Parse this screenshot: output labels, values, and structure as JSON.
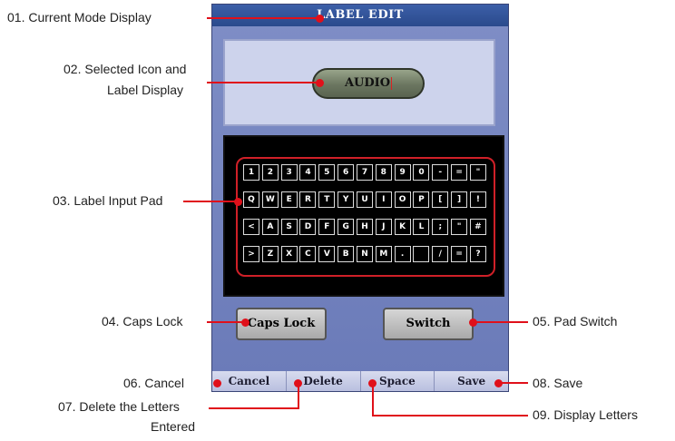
{
  "screen": {
    "title": "LABEL EDIT",
    "selected_label": "AUDIO",
    "keyboard_rows": [
      [
        "1",
        "2",
        "3",
        "4",
        "5",
        "6",
        "7",
        "8",
        "9",
        "0",
        "-",
        "=",
        "\""
      ],
      [
        "Q",
        "W",
        "E",
        "R",
        "T",
        "Y",
        "U",
        "I",
        "O",
        "P",
        "[",
        "]",
        "!"
      ],
      [
        "<",
        "A",
        "S",
        "D",
        "F",
        "G",
        "H",
        "J",
        "K",
        "L",
        ";",
        "\"",
        "#"
      ],
      [
        ">",
        "Z",
        "X",
        "C",
        "V",
        "B",
        "N",
        "M",
        ".",
        "",
        "/",
        "=",
        "?"
      ]
    ],
    "caps_lock_label": "Caps Lock",
    "switch_label": "Switch",
    "bottom_buttons": [
      "Cancel",
      "Delete",
      "Space",
      "Save"
    ]
  },
  "callouts": {
    "c01": "01. Current Mode Display",
    "c02a": "02. Selected Icon and",
    "c02b": "Label Display",
    "c03": "03. Label Input Pad",
    "c04": "04. Caps Lock",
    "c05": "05. Pad Switch",
    "c06": "06. Cancel",
    "c07a": "07. Delete the Letters",
    "c07b": "Entered",
    "c08": "08. Save",
    "c09": "09. Display Letters"
  },
  "colors": {
    "callout_red": "#e0101a",
    "title_blue": "#2a4a8c"
  }
}
